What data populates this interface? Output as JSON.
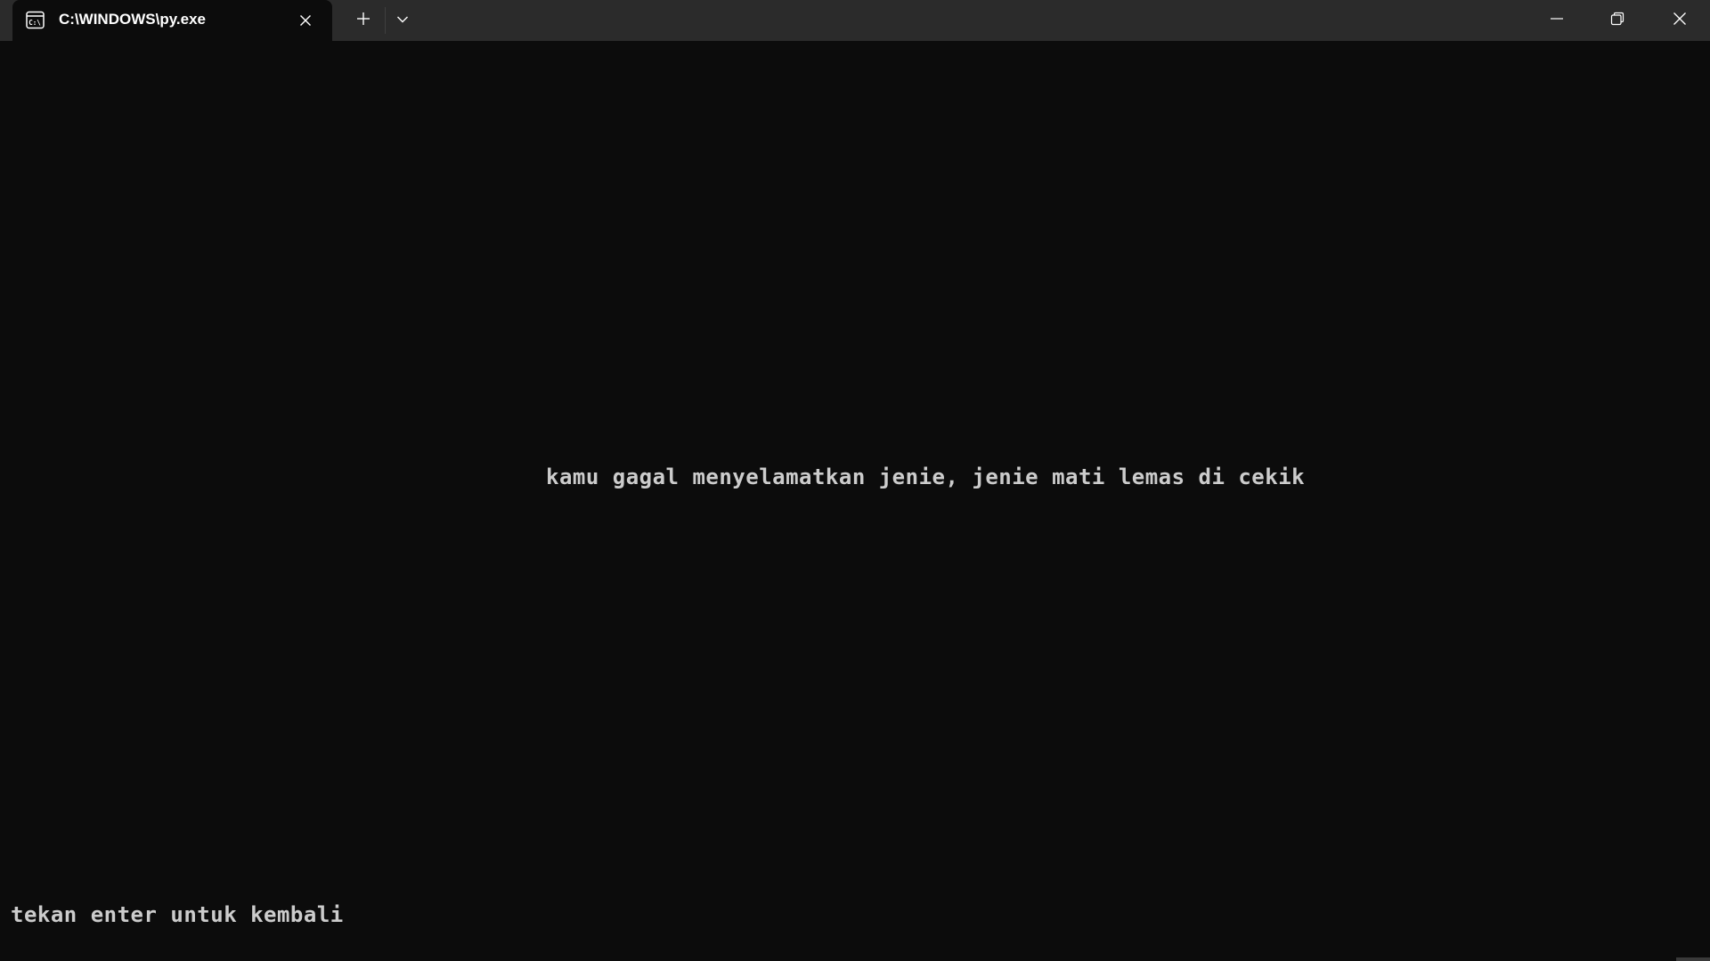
{
  "tab": {
    "title": "C:\\WINDOWS\\py.exe",
    "icon": "terminal-icon"
  },
  "titlebar": {
    "new_tab_icon": "plus-icon",
    "dropdown_icon": "chevron-down-icon",
    "minimize_icon": "minimize-icon",
    "restore_icon": "restore-icon",
    "close_icon": "close-icon"
  },
  "console": {
    "lines": [
      "kamu gagal menyelamatkan jenie, jenie mati lemas di cekik",
      "tekan enter untuk kembali"
    ],
    "text_color": "#cccccc",
    "background": "#0c0c0c"
  }
}
